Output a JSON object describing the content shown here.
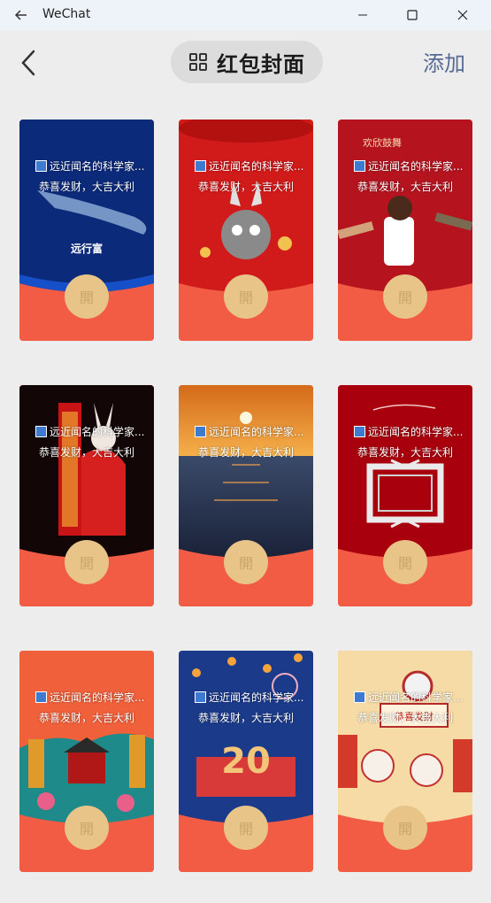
{
  "window": {
    "title": "WeChat"
  },
  "header": {
    "title": "红包封面",
    "add_label": "添加"
  },
  "cards": [
    {
      "sender": "远近闻名的科学家...",
      "greeting": "恭喜发财，大吉大利",
      "open_label": "開",
      "art_text": "远行富",
      "theme": "whale"
    },
    {
      "sender": "远近闻名的科学家...",
      "greeting": "恭喜发财，大吉大利",
      "open_label": "開",
      "art_text": "",
      "theme": "rabbit-cat"
    },
    {
      "sender": "远近闻名的科学家...",
      "greeting": "恭喜发财，大吉大利",
      "open_label": "開",
      "art_text": "欢欣鼓舞",
      "theme": "dance"
    },
    {
      "sender": "远近闻名的科学家...",
      "greeting": "恭喜发财，大吉大利",
      "open_label": "開",
      "art_text": "",
      "theme": "firecracker"
    },
    {
      "sender": "远近闻名的科学家...",
      "greeting": "恭喜发财，大吉大利",
      "open_label": "開",
      "art_text": "",
      "theme": "sunset"
    },
    {
      "sender": "远近闻名的科学家...",
      "greeting": "恭喜发财，大吉大利",
      "open_label": "開",
      "art_text": "",
      "theme": "frame"
    },
    {
      "sender": "远近闻名的科学家...",
      "greeting": "恭喜发财，大吉大利",
      "open_label": "開",
      "art_text": "",
      "theme": "china"
    },
    {
      "sender": "远近闻名的科学家...",
      "greeting": "恭喜发财，大吉大利",
      "open_label": "開",
      "art_text": "20",
      "theme": "lanterns"
    },
    {
      "sender": "远近闻名的科学家...",
      "greeting": "恭喜发财，大吉大利",
      "open_label": "開",
      "art_text": "恭喜发财",
      "theme": "illustration"
    }
  ],
  "colors": {
    "accent": "#576b95",
    "envelope_red": "#f25b44",
    "open_button": "#e8c488"
  }
}
